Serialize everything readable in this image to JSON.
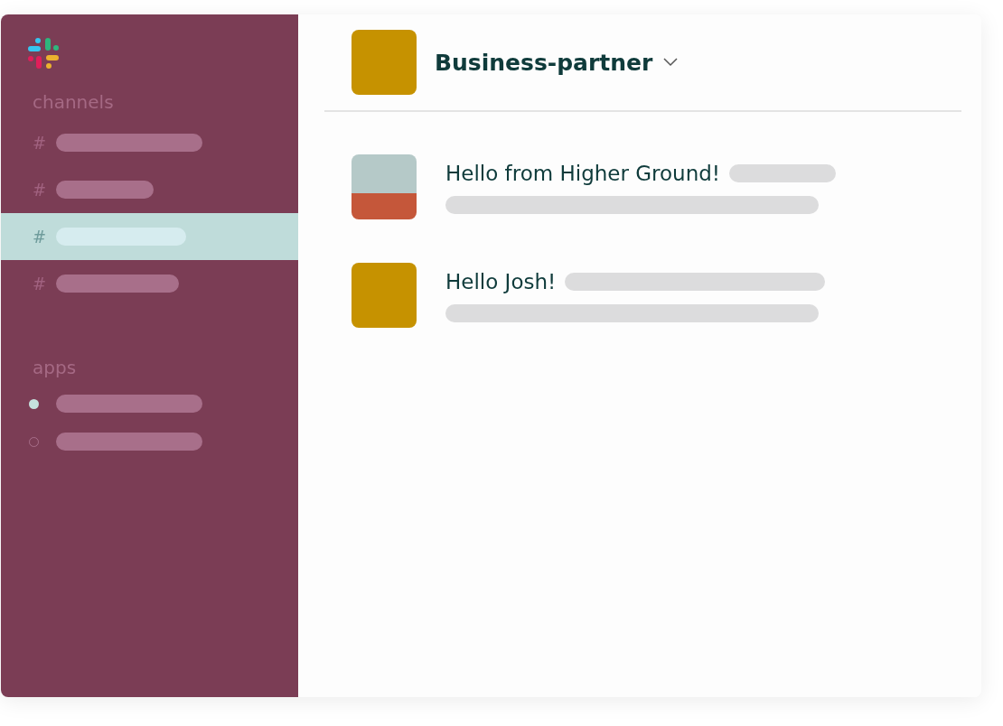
{
  "sidebar": {
    "sections": [
      {
        "heading": "channels",
        "items": [
          {
            "kind": "channel",
            "prefix": "#",
            "selected": false
          },
          {
            "kind": "channel",
            "prefix": "#",
            "selected": false
          },
          {
            "kind": "channel",
            "prefix": "#",
            "selected": true
          },
          {
            "kind": "channel",
            "prefix": "#",
            "selected": false
          }
        ]
      },
      {
        "heading": "apps",
        "items": [
          {
            "kind": "app",
            "online": true
          },
          {
            "kind": "app",
            "online": false
          }
        ]
      }
    ]
  },
  "header": {
    "title": "Business-partner"
  },
  "messages": [
    {
      "kind": "photo",
      "text": "Hello from Higher Ground!"
    },
    {
      "kind": "square",
      "text": "Hello Josh!"
    }
  ]
}
